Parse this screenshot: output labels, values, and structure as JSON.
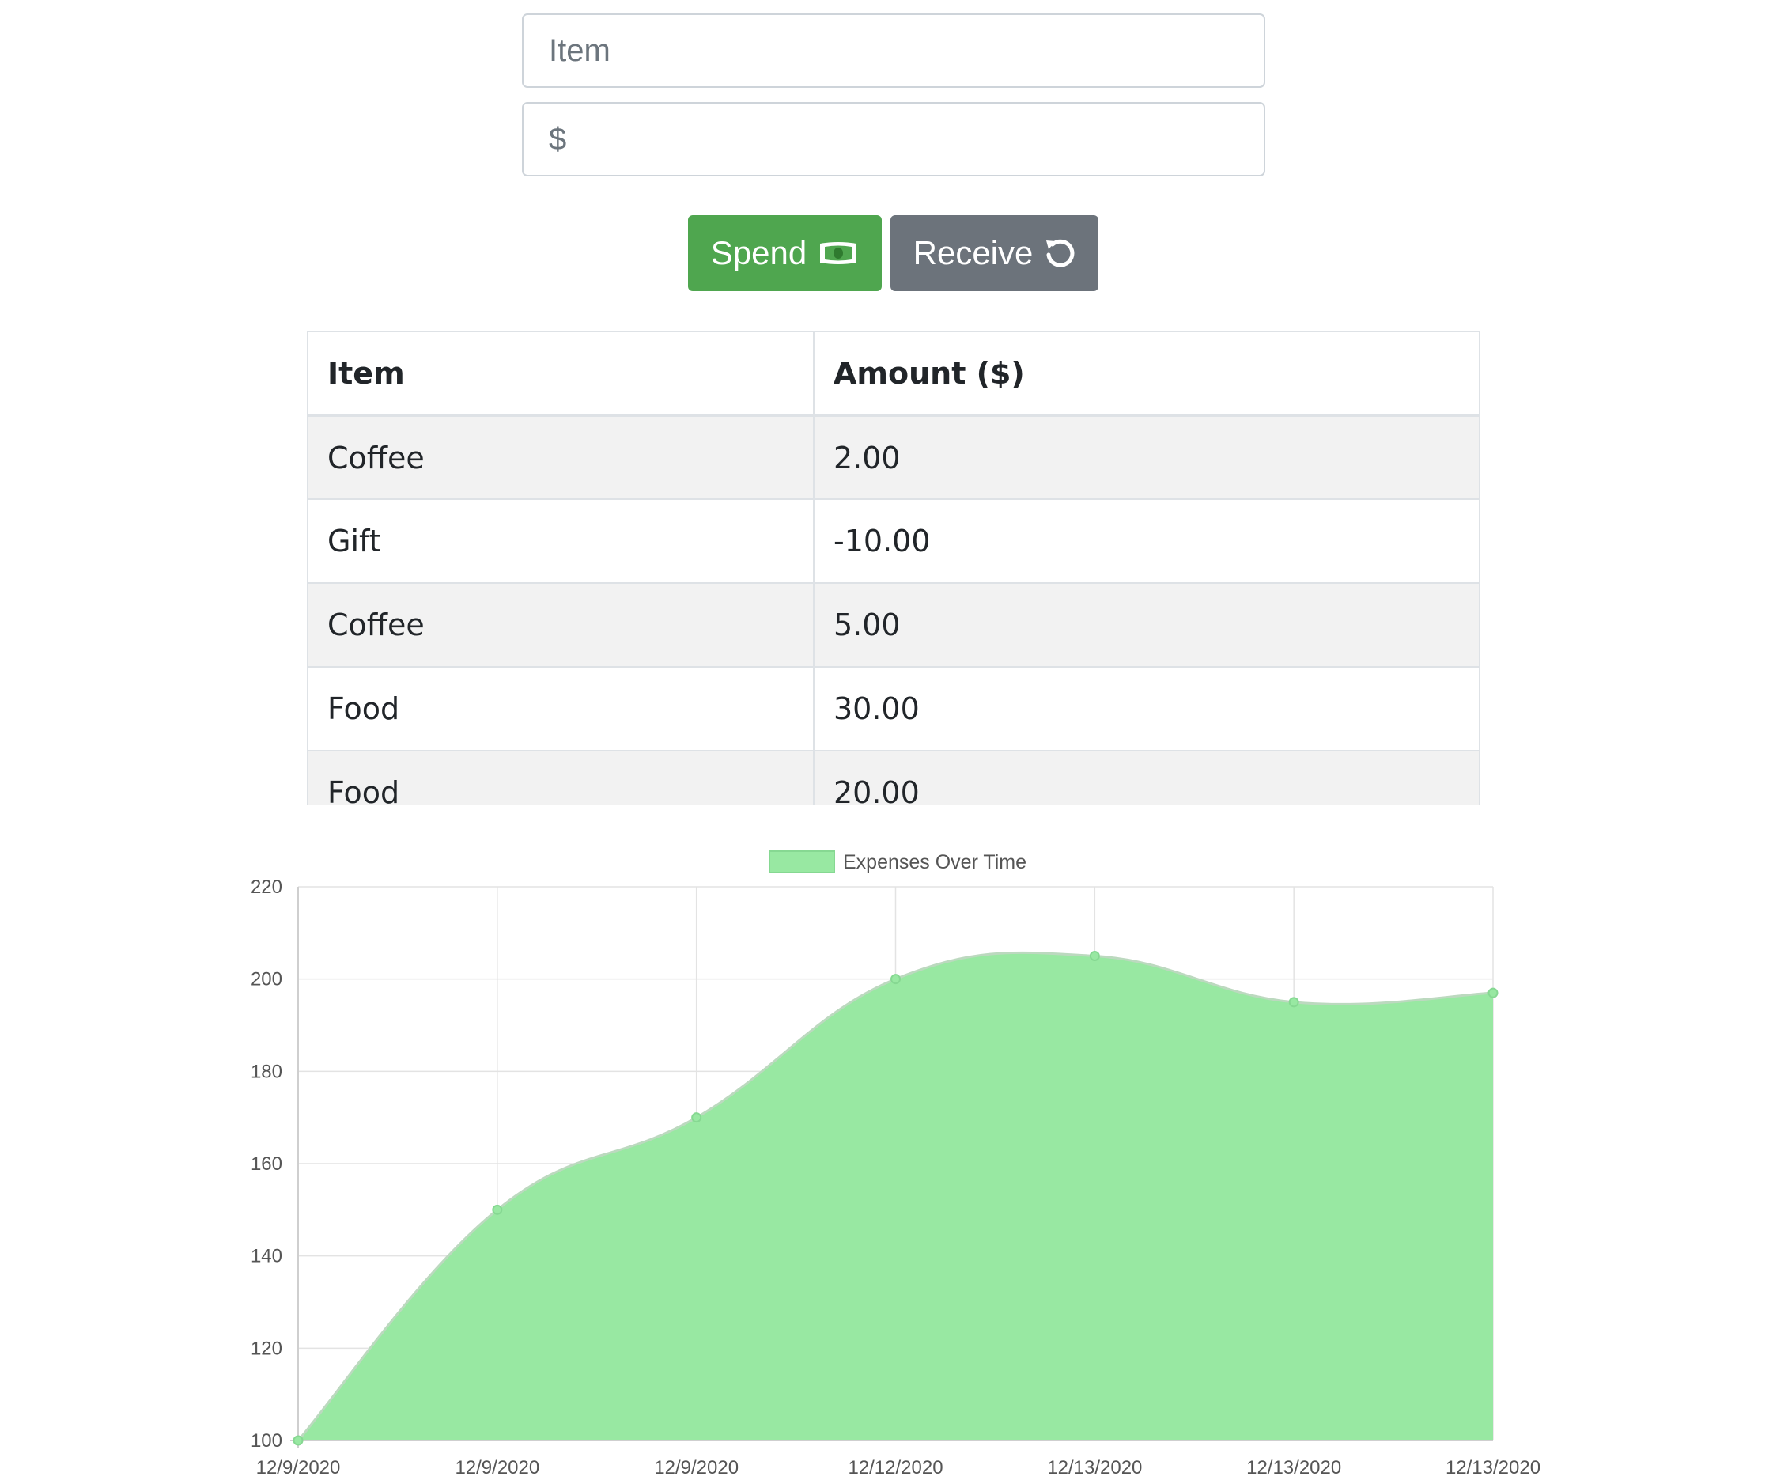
{
  "form": {
    "item_placeholder": "Item",
    "amount_placeholder": "$",
    "spend_label": "Spend",
    "receive_label": "Receive",
    "spend_icon": "money-bill-icon",
    "receive_icon": "undo-icon"
  },
  "colors": {
    "spend": "#4fa64f",
    "receive": "#6c737b",
    "chart_fill": "#98e8a2",
    "chart_line": "#bcd9bf"
  },
  "table": {
    "headers": [
      "Item",
      "Amount ($)"
    ],
    "rows": [
      [
        "Coffee",
        "2.00"
      ],
      [
        "Gift",
        "-10.00"
      ],
      [
        "Coffee",
        "5.00"
      ],
      [
        "Food",
        "30.00"
      ],
      [
        "Food",
        "20.00"
      ]
    ]
  },
  "chart_data": {
    "type": "area",
    "x": [
      "12/9/2020",
      "12/9/2020",
      "12/9/2020",
      "12/12/2020",
      "12/13/2020",
      "12/13/2020",
      "12/13/2020"
    ],
    "series": [
      {
        "name": "Expenses Over Time",
        "values": [
          100,
          150,
          170,
          200,
          205,
          195,
          197
        ]
      }
    ],
    "ylim": [
      100,
      220
    ],
    "yticks": [
      100,
      120,
      140,
      160,
      180,
      200,
      220
    ],
    "grid": true,
    "legend": "top-center"
  }
}
